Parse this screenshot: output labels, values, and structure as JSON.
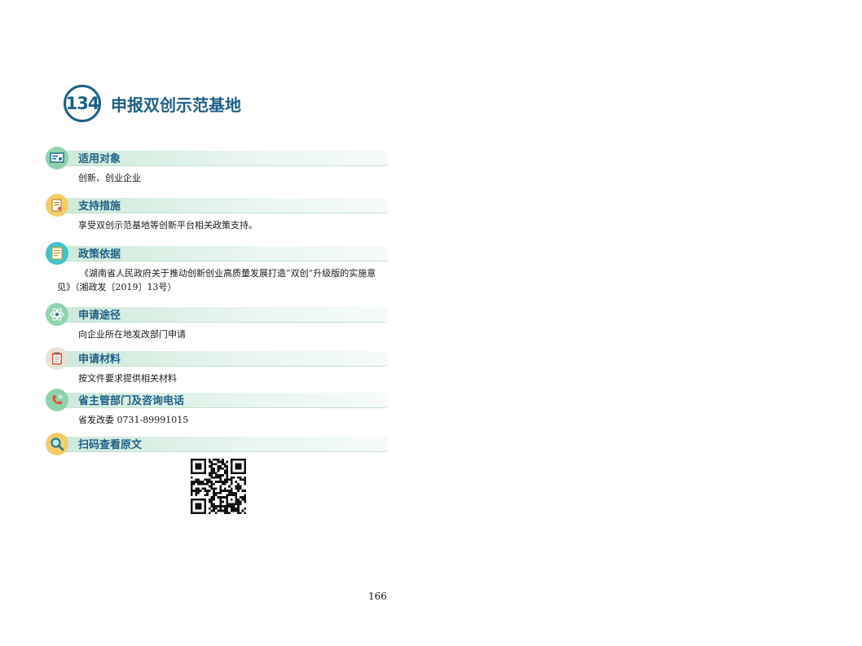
{
  "header": {
    "number": "134",
    "title": "申报双创示范基地"
  },
  "sections": [
    {
      "title": "适用对象",
      "body": "创新、创业企业",
      "icon": "certificate-icon",
      "color": "#8fd3ad"
    },
    {
      "title": "支持措施",
      "body": "享受双创示范基地等创新平台相关政策支持。",
      "icon": "document-icon",
      "color": "#f3cd6a"
    },
    {
      "title": "政策依据",
      "body": "《湖南省人民政府关于推动创新创业高质量发展打造“双创”升级版的实施意见》（湘政发〔2019〕13号）",
      "icon": "policy-document-icon",
      "color": "#3cc4c8"
    },
    {
      "title": "申请途径",
      "body": "向企业所在地发改部门申请",
      "icon": "atom-icon",
      "color": "#8fd3ad"
    },
    {
      "title": "申请材料",
      "body": "按文件要求提供相关材料",
      "icon": "clipboard-icon",
      "color": "#e9e2d4"
    },
    {
      "title": "省主管部门及咨询电话",
      "body": "省发改委 0731-89991015",
      "icon": "phone-icon",
      "color": "#8fd3ad"
    },
    {
      "title": "扫码查看原文",
      "body": "",
      "icon": "magnifier-icon",
      "color": "#f3cd6a"
    }
  ],
  "qr": {
    "icon": "qr-code-icon"
  },
  "footer": {
    "page": "166"
  }
}
